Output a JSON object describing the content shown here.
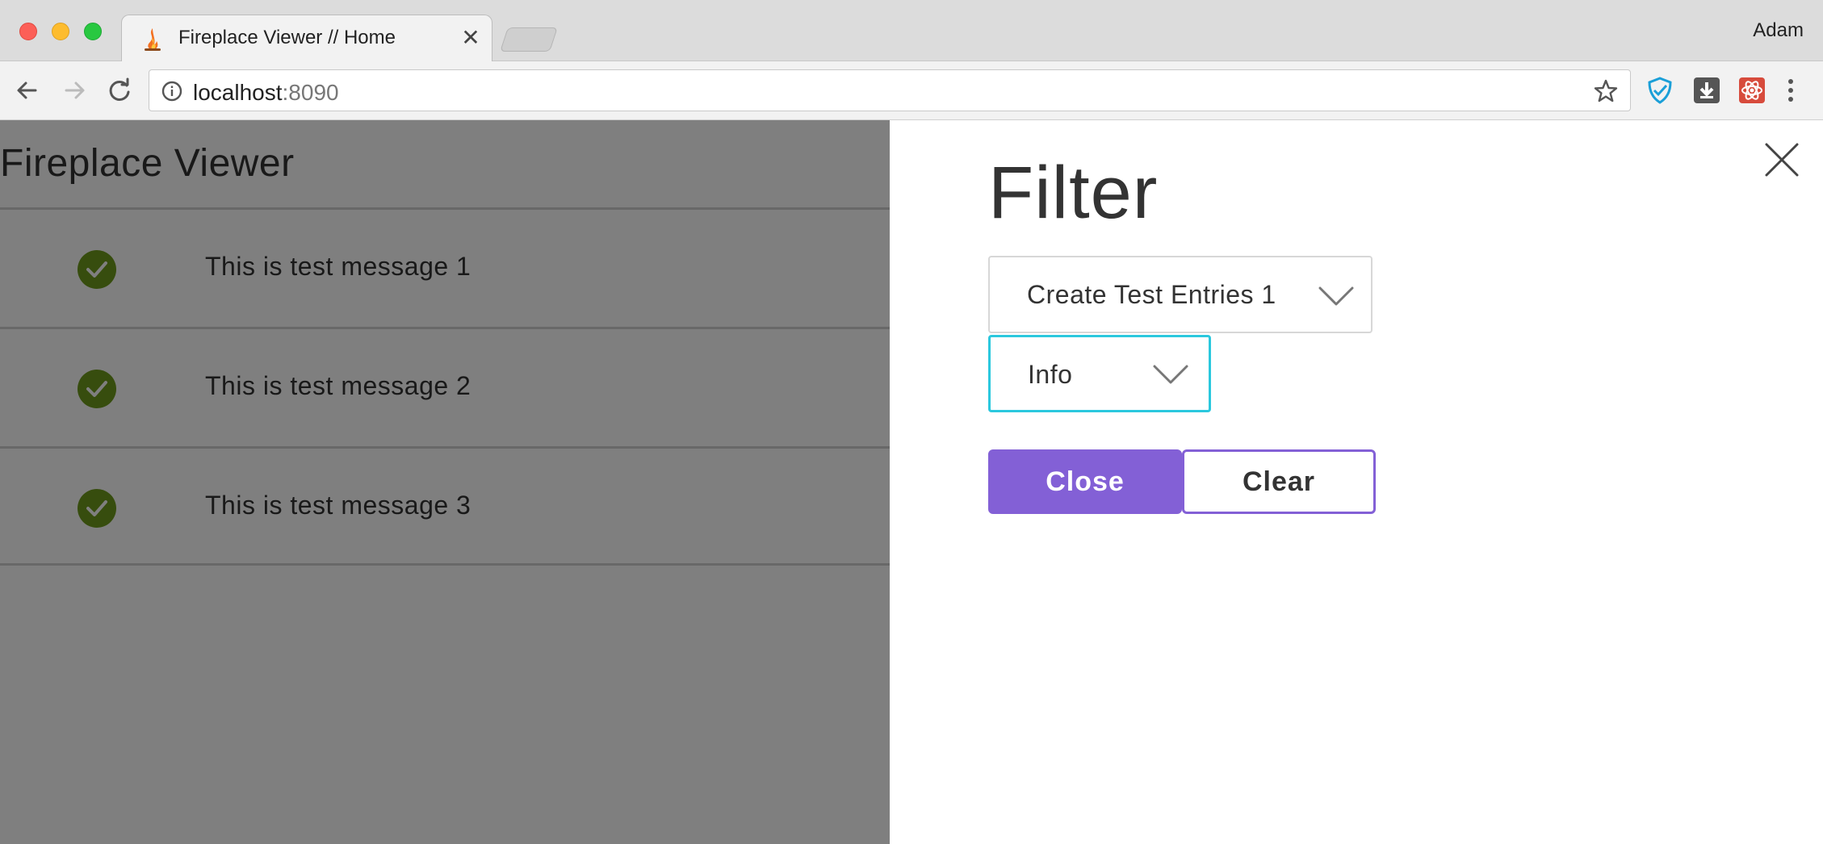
{
  "browser": {
    "tab_title": "Fireplace Viewer // Home",
    "tab_close": "✕",
    "profile_name": "Adam",
    "url_host": "localhost",
    "url_port": ":8090",
    "icons": [
      "back-arrow-icon",
      "forward-arrow-icon",
      "reload-icon",
      "info-icon",
      "star-icon",
      "shield-extension-icon",
      "download-extension-icon",
      "react-devtools-icon",
      "menu-dots-icon"
    ]
  },
  "app": {
    "title": "Fireplace Viewer",
    "messages": [
      {
        "text": "This is test message 1",
        "status": "success"
      },
      {
        "text": "This is test message 2",
        "status": "success"
      },
      {
        "text": "This is test message 3",
        "status": "success"
      }
    ]
  },
  "filter": {
    "title": "Filter",
    "source_select": "Create Test Entries 1",
    "level_select": "Info",
    "close_button": "Close",
    "clear_button": "Clear"
  },
  "colors": {
    "accent": "#8360d6",
    "focus": "#2bc8de",
    "success": "#6e9a1c",
    "overlay": "rgba(0,0,0,0.5)"
  }
}
